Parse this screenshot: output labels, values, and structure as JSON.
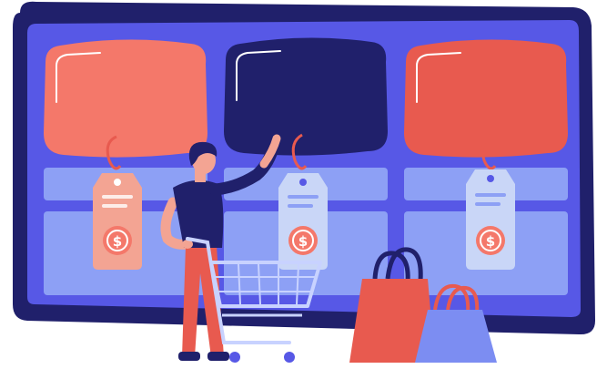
{
  "illustration": {
    "price_symbol": "$",
    "colors": {
      "frame": "#20206b",
      "screen": "#5758e6",
      "shelf": "#8da0f5",
      "card_salmon": "#f4786a",
      "card_navy": "#20206b",
      "card_red": "#e85a4f",
      "tag_salmon": "#f3a493",
      "tag_light": "#c9d6f7",
      "coin": "#f4786a",
      "bag_red": "#e85a4f",
      "bag_blue": "#7c8df2",
      "skin": "#f3a493",
      "hair": "#20206b",
      "shirt": "#20206b",
      "pants": "#e85a4f",
      "cart": "#c8d2ff"
    }
  }
}
